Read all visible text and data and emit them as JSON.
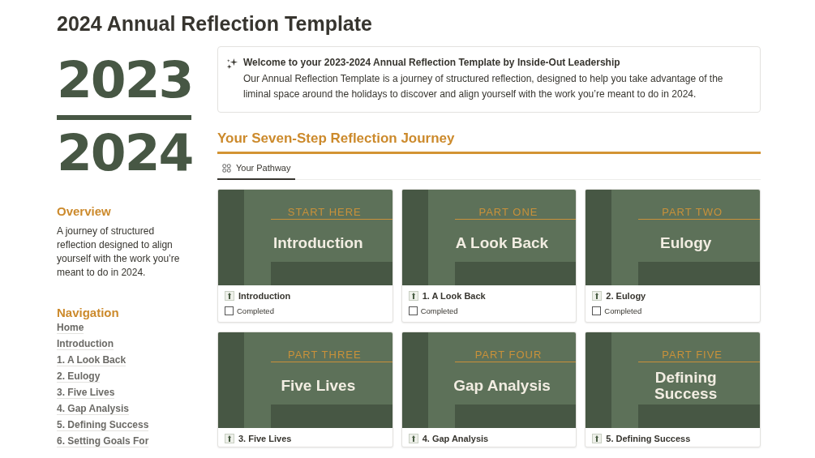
{
  "page": {
    "title": "2024 Annual Reflection Template"
  },
  "year_banner": {
    "from": "2023",
    "to": "2024"
  },
  "overview": {
    "heading": "Overview",
    "text": "A journey of structured reflection designed to align yourself with the work you’re meant to do in 2024."
  },
  "navigation": {
    "heading": "Navigation",
    "links": [
      "Home",
      "Introduction",
      "1. A Look Back",
      "2. Eulogy",
      "3. Five Lives",
      "4. Gap Analysis",
      "5. Defining Success",
      "6. Setting Goals For"
    ]
  },
  "callout": {
    "title": "Welcome to your 2023-2024 Annual Reflection Template by Inside-Out Leadership",
    "text": "Our Annual Reflection Template is a journey of structured reflection, designed to help you take advantage of the liminal space around the holidays to discover and align yourself with the work you’re meant to do in 2024."
  },
  "section_heading": "Your Seven-Step Reflection Journey",
  "views": [
    {
      "label": "Your Pathway",
      "selected": true
    }
  ],
  "cards": [
    {
      "cover_label": "START HERE",
      "cover_title": "Introduction",
      "title": "Introduction",
      "checkbox_label": "Completed",
      "checked": false
    },
    {
      "cover_label": "PART ONE",
      "cover_title": "A Look Back",
      "title": "1. A Look Back",
      "checkbox_label": "Completed",
      "checked": false
    },
    {
      "cover_label": "PART TWO",
      "cover_title": "Eulogy",
      "title": "2. Eulogy",
      "checkbox_label": "Completed",
      "checked": false
    },
    {
      "cover_label": "PART THREE",
      "cover_title": "Five Lives",
      "title": "3. Five Lives"
    },
    {
      "cover_label": "PART FOUR",
      "cover_title": "Gap Analysis",
      "title": "4. Gap Analysis"
    },
    {
      "cover_label": "PART FIVE",
      "cover_title": "Defining Success",
      "title": "5. Defining Success"
    }
  ]
}
